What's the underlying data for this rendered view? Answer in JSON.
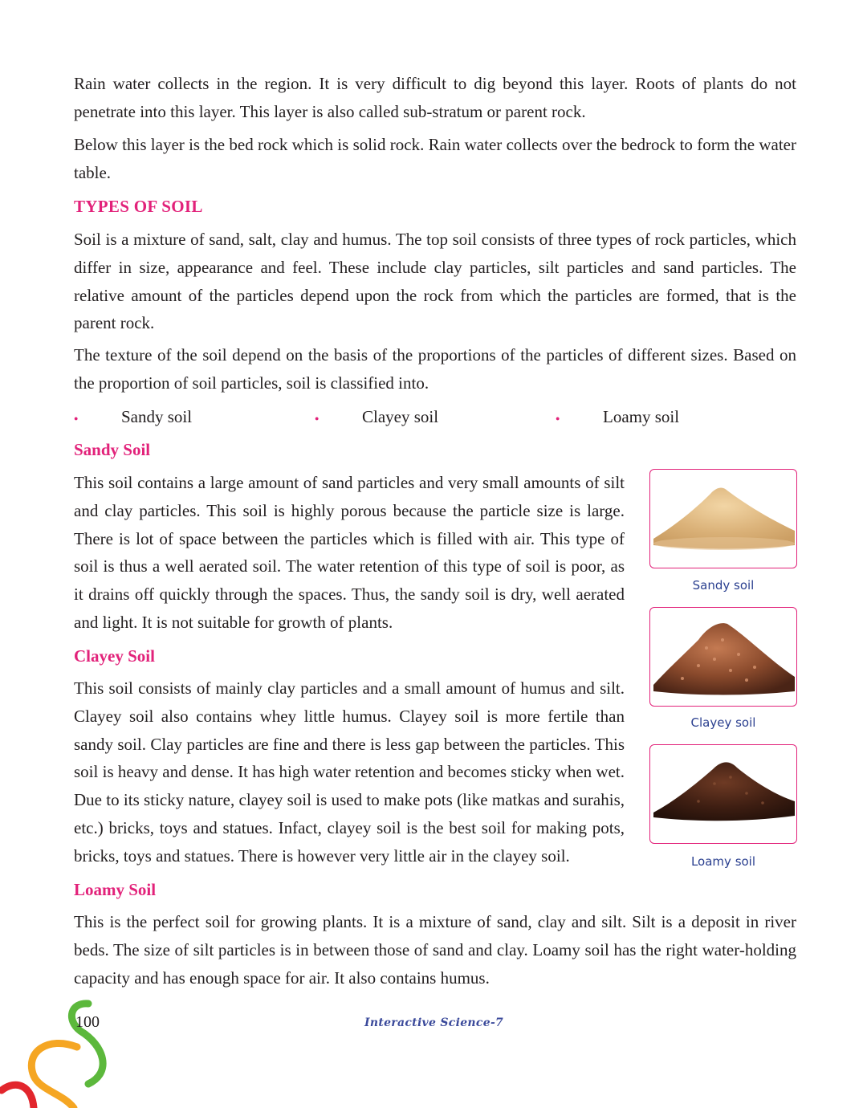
{
  "intro": {
    "p1": "Rain water collects in the region. It is very difficult to dig beyond this layer. Roots of plants do not penetrate into this layer. This layer is also called sub-stratum or parent rock.",
    "p2": "Below this layer is the bed rock which is solid rock. Rain water collects over the bedrock to form the water table."
  },
  "types": {
    "heading": "TYPES OF SOIL",
    "p1": "Soil is a mixture of sand, salt, clay and humus. The top soil consists of three types of rock particles, which differ in size, appearance and feel. These include clay particles, silt particles and sand particles. The relative amount of the particles depend upon the rock from which the particles are formed, that is the parent rock.",
    "p2": "The texture of the soil depend on the basis of the proportions of the particles of different sizes. Based on the proportion of soil particles, soil is classified into.",
    "list": [
      "Sandy soil",
      "Clayey soil",
      "Loamy soil"
    ]
  },
  "sandy": {
    "heading": "Sandy Soil",
    "body": "This soil contains a large amount of sand particles and very small amounts of silt and clay particles. This soil is highly porous because the particle size is large. There is lot of space between the particles which is filled with air. This type of soil is thus a well aerated soil. The water retention of this type of soil is poor, as it drains off quickly through the spaces. Thus, the sandy soil is dry, well aerated and light. It is not suitable for growth of plants."
  },
  "clayey": {
    "heading": "Clayey Soil",
    "body": "This soil consists of mainly clay particles and a small amount of humus and silt. Clayey soil also contains whey little humus. Clayey soil is more fertile than sandy soil. Clay particles are fine and there is less gap between the particles. This soil is heavy and dense. It has high water retention and becomes sticky when wet. Due to its sticky nature, clayey soil is used to make pots (like matkas and surahis, etc.) bricks, toys and statues. Infact, clayey soil is the best soil for making pots, bricks, toys and statues. There is however very little air in the clayey soil."
  },
  "loamy": {
    "heading": "Loamy Soil",
    "body": "This is the perfect soil for growing plants. It is a mixture of sand, clay and silt. Silt is a deposit in river beds. The size of silt particles is in between those of sand and clay. Loamy soil has the right water-holding capacity and has enough space for air. It also contains humus."
  },
  "figures": {
    "sandy_caption": "Sandy soil",
    "clayey_caption": "Clayey soil",
    "loamy_caption": "Loamy soil"
  },
  "footer": {
    "page_number": "100",
    "book_title": "Interactive Science-7"
  },
  "colors": {
    "heading": "#e2227a",
    "caption": "#2a3f8f",
    "frame": "#e2227a"
  }
}
